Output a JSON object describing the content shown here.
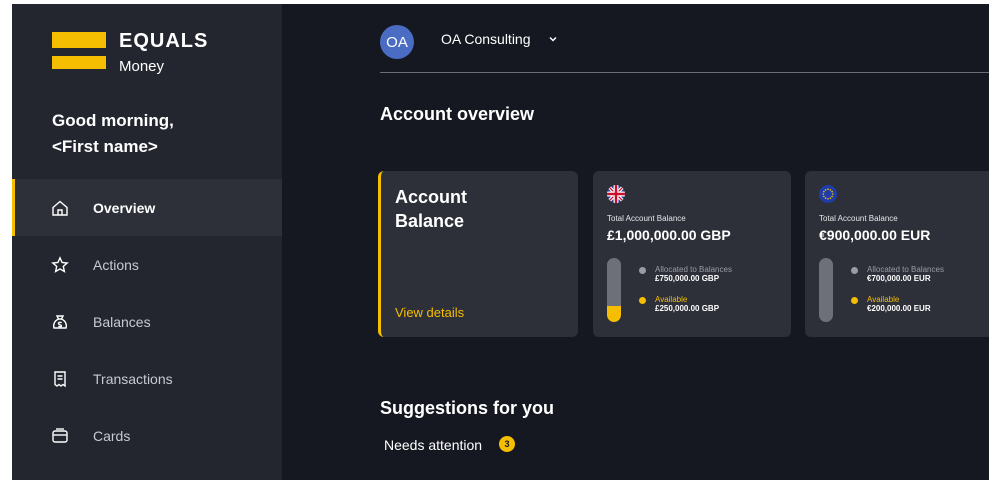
{
  "brand": {
    "name": "EQUALS",
    "sub": "Money"
  },
  "greeting": {
    "line1": "Good morning,",
    "line2": "<First name>"
  },
  "nav": [
    {
      "label": "Overview",
      "icon": "home-icon",
      "active": true
    },
    {
      "label": "Actions",
      "icon": "star-icon",
      "active": false
    },
    {
      "label": "Balances",
      "icon": "money-bag-icon",
      "active": false
    },
    {
      "label": "Transactions",
      "icon": "receipt-icon",
      "active": false
    },
    {
      "label": "Cards",
      "icon": "card-icon",
      "active": false
    }
  ],
  "header": {
    "avatar_initials": "OA",
    "org_name": "OA Consulting"
  },
  "overview": {
    "title": "Account overview",
    "summary": {
      "title_line1": "Account",
      "title_line2": "Balance",
      "link": "View details"
    },
    "accounts": [
      {
        "currency": "GBP",
        "flag_icon": "uk-flag-icon",
        "label": "Total Account Balance",
        "total": "£1,000,000.00 GBP",
        "available_fraction": 0.25,
        "allocated_label": "Allocated to Balances",
        "allocated_value": "£750,000.00 GBP",
        "available_label": "Available",
        "available_value": "£250,000.00 GBP"
      },
      {
        "currency": "EUR",
        "flag_icon": "eu-flag-icon",
        "label": "Total Account Balance",
        "total": "€900,000.00 EUR",
        "available_fraction": 0.0,
        "allocated_label": "Allocated to Balances",
        "allocated_value": "€700,000.00 EUR",
        "available_label": "Available",
        "available_value": "€200,000.00 EUR"
      }
    ]
  },
  "suggestions": {
    "title": "Suggestions for you",
    "needs_attention": "Needs attention",
    "count": "3"
  },
  "colors": {
    "accent": "#f5be00",
    "background": "#151821",
    "sidebar": "#23262f",
    "card": "#2d3039"
  }
}
